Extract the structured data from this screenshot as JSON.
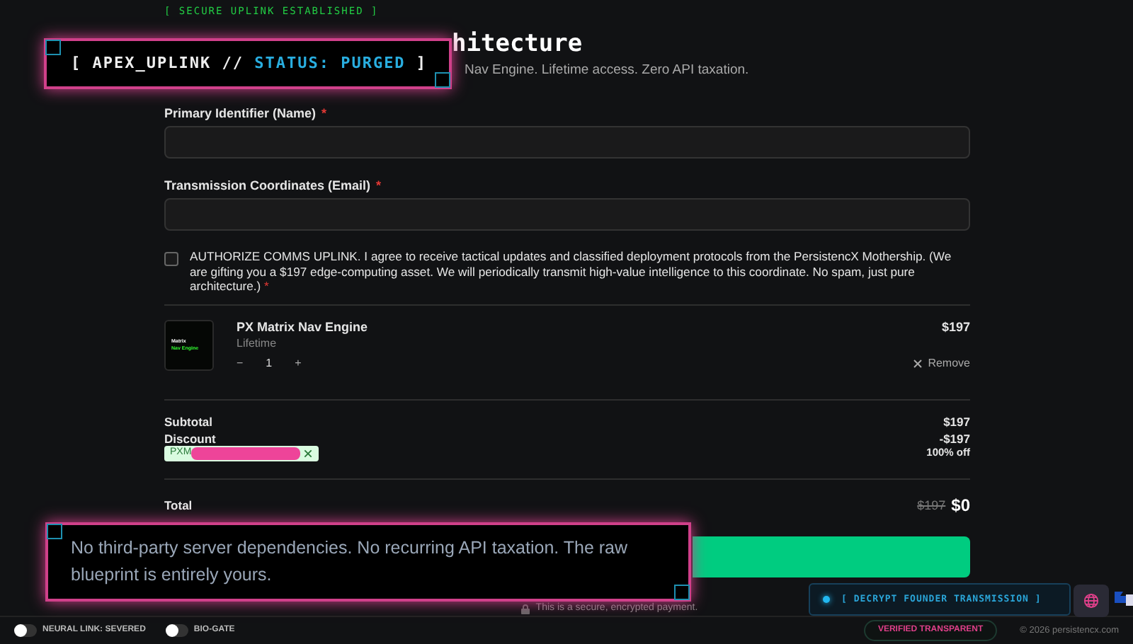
{
  "header": {
    "tagline": "[ SECURE UPLINK ESTABLISHED ]",
    "title": "hitecture",
    "subtitle": "Nav Engine. Lifetime access. Zero API taxation."
  },
  "fields": [
    {
      "label": "Primary Identifier (Name)",
      "required_mark": "*"
    },
    {
      "label": "Transmission Coordinates (Email)",
      "required_mark": "*"
    }
  ],
  "consent": {
    "checked": false,
    "text": "AUTHORIZE COMMS UPLINK. I agree to receive tactical updates and classified deployment protocols from the PersistencX Mothership. (We are gifting you a $197 edge-computing asset. We will periodically transmit high-value intelligence to this coordinate. No spam, just pure architecture.)",
    "required_mark": "*"
  },
  "product": {
    "name": "PX Matrix Nav Engine",
    "term": "Lifetime",
    "price": "$197",
    "quantity": "1",
    "minus": "−",
    "plus": "+",
    "remove": "Remove",
    "thumb_lines": [
      "Matrix",
      "Nav Engine"
    ]
  },
  "summary": {
    "subtotal_label": "Subtotal",
    "subtotal": "$197",
    "discount_label": "Discount",
    "discount": "-$197",
    "discount_note": "100% off",
    "code": "PXM",
    "total_label": "Total",
    "total_old": "$197",
    "total": "$0"
  },
  "secure_note": "This is a secure, encrypted payment.",
  "overlay_top": {
    "prefix": "[ APEX_UPLINK // ",
    "status": "STATUS: PURGED",
    "suffix": " ]"
  },
  "overlay_bottom": {
    "text": "No third-party server dependencies. No recurring API taxation. The raw blueprint is entirely yours."
  },
  "decrypt_button": "[ DECRYPT FOUNDER TRANSMISSION ]",
  "toggles": [
    {
      "label": "NEURAL LINK: SEVERED",
      "on": false
    },
    {
      "label": "BIO-GATE",
      "on": false
    }
  ],
  "badge": "VERIFIED TRANSPARENT",
  "copyright": "© 2026 persistencx.com"
}
